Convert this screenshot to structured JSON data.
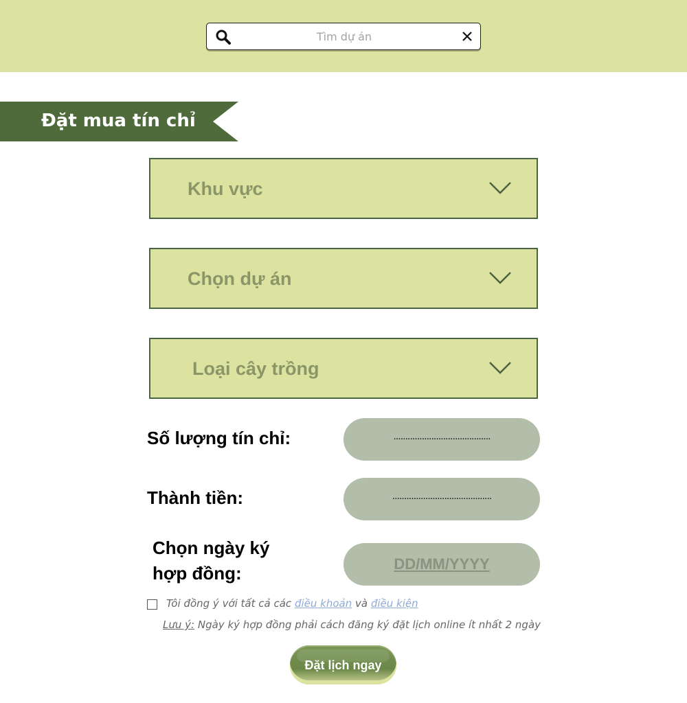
{
  "search": {
    "placeholder": "Tìm dự án"
  },
  "banner": {
    "title": "Đặt mua tín chỉ"
  },
  "dropdowns": [
    {
      "label": "Khu vực"
    },
    {
      "label": "Chọn dự án"
    },
    {
      "label": "Loại cây trồng"
    }
  ],
  "fields": {
    "credits": {
      "label": "Số lượng tín chỉ:",
      "value": "........................................."
    },
    "total": {
      "label": "Thành tiền:",
      "value": ".........................................."
    },
    "date": {
      "label": "Chọn ngày ký hợp đồng:",
      "placeholder": "DD/MM/YYYY"
    }
  },
  "agreement": {
    "prefix": "Tôi đồng ý với tất cả các",
    "terms_link": "điều khoản",
    "conjunction": "và",
    "conditions_link": "điều kiện"
  },
  "note": {
    "label": "Lưu ý:",
    "text": "Ngày ký hợp đồng phải cách đăng ký đặt lịch online ít nhất 2 ngày"
  },
  "submit": {
    "label": "Đặt lịch ngay"
  },
  "colors": {
    "header_bg": "#dce29f",
    "banner_bg": "#4f6b3c",
    "dropdown_bg": "#dce29f",
    "dropdown_border": "#4a6340",
    "pill_bg": "#b2bdaa",
    "link": "#8faad6"
  }
}
